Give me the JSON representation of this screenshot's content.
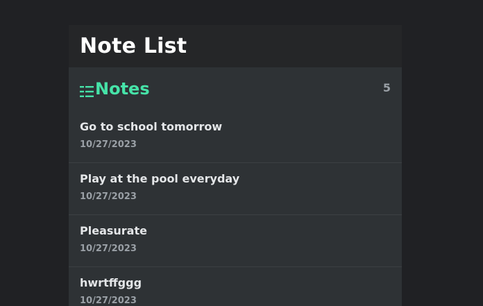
{
  "header": {
    "title": "Note List"
  },
  "notes_section": {
    "title": "Notes",
    "icon": "list-icon",
    "count": "5",
    "accent_color": "#46e3a8"
  },
  "notes": [
    {
      "title": "Go to school tomorrow",
      "date": "10/27/2023"
    },
    {
      "title": "Play at the pool everyday",
      "date": "10/27/2023"
    },
    {
      "title": "Pleasurate",
      "date": "10/27/2023"
    },
    {
      "title": "hwrtffggg",
      "date": "10/27/2023"
    }
  ]
}
